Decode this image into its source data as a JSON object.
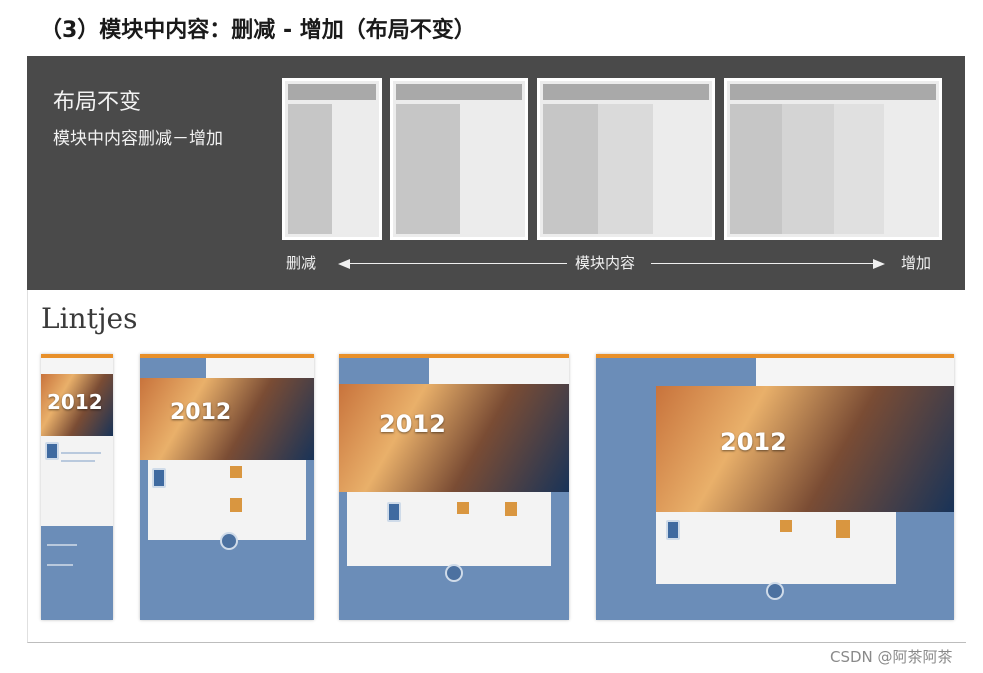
{
  "heading": "（3）模块中内容：删减 - 增加（布局不变）",
  "panel": {
    "title": "布局不变",
    "subtitle": "模块中内容删减－增加",
    "axis": {
      "left_label": "删减",
      "center_label": "模块内容",
      "right_label": "增加"
    }
  },
  "lower": {
    "brand": "Lintjes",
    "year_text": "2012"
  },
  "watermark": "CSDN @阿茶阿茶",
  "colors": {
    "panel_bg": "#4a4a4a",
    "site_blue": "#6b8db8",
    "site_orange": "#e8902a"
  }
}
